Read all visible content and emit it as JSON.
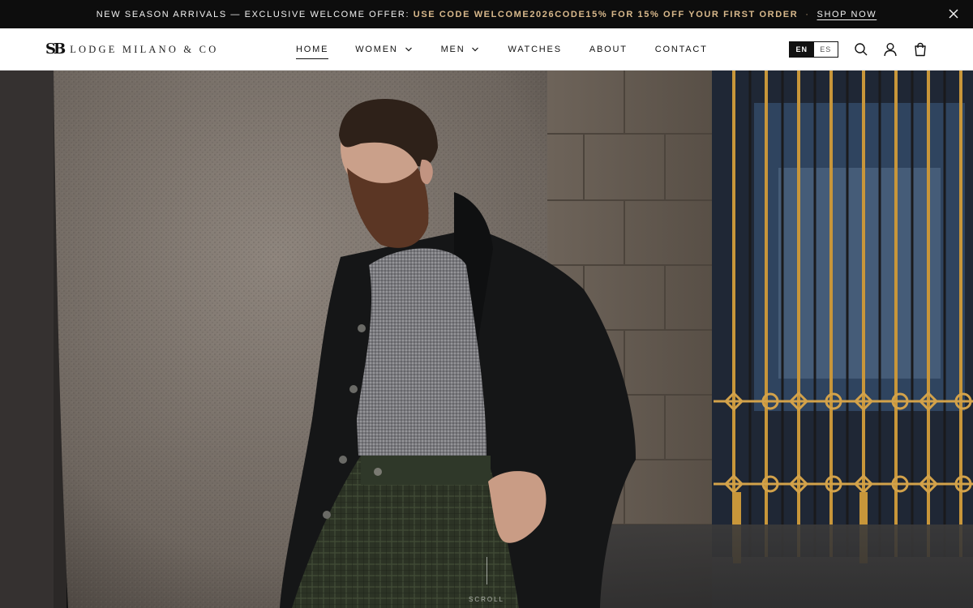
{
  "announcement": {
    "text_before": "NEW SEASON ARRIVALS — EXCLUSIVE WELCOME OFFER: ",
    "code_text": "USE CODE WELCOME2026CODE15% FOR 15% OFF YOUR FIRST ORDER",
    "separator": "·",
    "link_label": "SHOP NOW",
    "close_icon": "close-icon"
  },
  "header": {
    "logo_mark": "SB",
    "brand_name": "LODGE MILANO & CO",
    "nav": [
      {
        "label": "HOME",
        "active": true
      },
      {
        "label": "WOMEN",
        "has_dropdown": true
      },
      {
        "label": "MEN",
        "has_dropdown": true
      },
      {
        "label": "WATCHES"
      },
      {
        "label": "ABOUT"
      },
      {
        "label": "CONTACT"
      }
    ],
    "languages": {
      "selected": "EN",
      "other": "ES"
    },
    "icons": [
      "search-icon",
      "account-icon",
      "cart-icon"
    ]
  },
  "hero": {
    "scroll_label": "SCROLL"
  },
  "colors": {
    "announcement_bg": "#0d0d0d",
    "code_accent": "#d9b98c",
    "header_bg": "#ffffff",
    "text_dark": "#111111"
  }
}
